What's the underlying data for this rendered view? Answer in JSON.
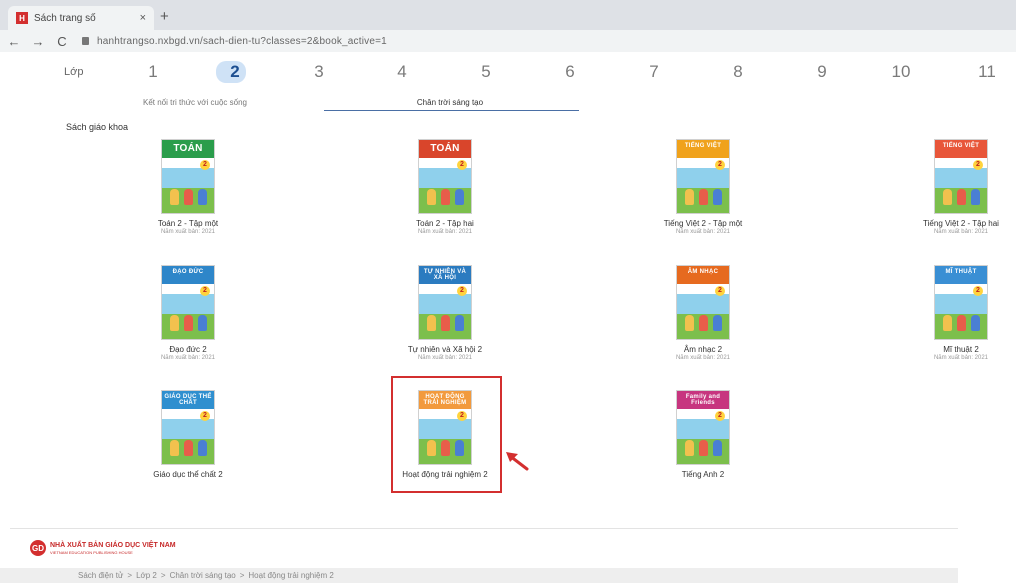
{
  "browser": {
    "tab_title": "Sách trang số",
    "tab_close": "×",
    "new_tab": "+",
    "back": "←",
    "forward": "→",
    "reload": "C",
    "url": "hanhtrangso.nxbgd.vn/sach-dien-tu?classes=2&book_active=1"
  },
  "grades": {
    "label": "Lớp",
    "items": [
      "1",
      "2",
      "3",
      "4",
      "5",
      "6",
      "7",
      "8",
      "9",
      "10",
      "11"
    ],
    "active": "2"
  },
  "series_tabs": [
    "Kết nối tri thức với cuộc sống",
    "Chân trời sáng tạo"
  ],
  "active_series": "Chân trời sáng tạo",
  "section_title": "Sách giáo khoa",
  "books": [
    {
      "title": "Toán 2 - Tập một",
      "year": "Năm xuất bản: 2021",
      "cover_text": "TOÁN",
      "color": "#2a9d4b"
    },
    {
      "title": "Toán 2 - Tập hai",
      "year": "Năm xuất bản: 2021",
      "cover_text": "TOÁN",
      "color": "#d9452b"
    },
    {
      "title": "Tiếng Việt 2 - Tập một",
      "year": "Năm xuất bản: 2021",
      "cover_text": "TIẾNG VIỆT",
      "color": "#f0a21c"
    },
    {
      "title": "Tiếng Việt 2 - Tập hai",
      "year": "Năm xuất bản: 2021",
      "cover_text": "TIẾNG VIỆT",
      "color": "#e8563a"
    },
    {
      "title": "Đạo đức 2",
      "year": "Năm xuất bản: 2021",
      "cover_text": "ĐẠO ĐỨC",
      "color": "#2e86c9"
    },
    {
      "title": "Tự nhiên và Xã hội 2",
      "year": "Năm xuất bản: 2021",
      "cover_text": "TỰ NHIÊN VÀ XÃ HỘI",
      "color": "#2b7bc0"
    },
    {
      "title": "Âm nhạc 2",
      "year": "Năm xuất bản: 2021",
      "cover_text": "ÂM NHẠC",
      "color": "#e66a1f"
    },
    {
      "title": "Mĩ thuật 2",
      "year": "Năm xuất bản: 2021",
      "cover_text": "MĨ THUẬT",
      "color": "#3a8fd4"
    },
    {
      "title": "Giáo dục thể chất 2",
      "year": "",
      "cover_text": "GIÁO DỤC THỂ CHẤT",
      "color": "#2f8fcf"
    },
    {
      "title": "Hoạt động trải nghiệm 2",
      "year": "",
      "cover_text": "HOẠT ĐỘNG TRẢI NGHIỆM",
      "color": "#f29a3d"
    },
    {
      "title": "Tiếng Anh 2",
      "year": "",
      "cover_text": "Family and Friends",
      "color": "#c7357f"
    }
  ],
  "footer": {
    "publisher_name": "NHÀ XUẤT BẢN GIÁO DỤC VIỆT NAM",
    "publisher_sub": "VIETNAM EDUCATION PUBLISHING HOUSE",
    "breadcrumb": [
      "Sách điện tử",
      ">",
      "Lớp 2",
      ">",
      "Chân trời sáng tạo",
      ">",
      "Hoạt động trải nghiệm 2"
    ]
  },
  "colors": {
    "accent": "#1d4f91",
    "highlight": "#d32f2f"
  }
}
